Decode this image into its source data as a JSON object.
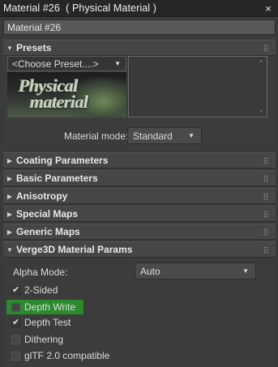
{
  "window": {
    "title": "Material #26  ( Physical Material )",
    "close_glyph": "×"
  },
  "name_field": {
    "value": "Material #26"
  },
  "presets": {
    "header": "Presets",
    "select_value": "<Choose Preset....>",
    "material_mode_label": "Material mode:",
    "material_mode_value": "Standard",
    "preview_logo_text": [
      "Physical",
      "material"
    ]
  },
  "rollouts": [
    {
      "label": "Coating Parameters",
      "expanded": false
    },
    {
      "label": "Basic Parameters",
      "expanded": false
    },
    {
      "label": "Anisotropy",
      "expanded": false
    },
    {
      "label": "Special Maps",
      "expanded": false
    },
    {
      "label": "Generic Maps",
      "expanded": false
    }
  ],
  "verge3d": {
    "header": "Verge3D Material Params",
    "alpha_mode_label": "Alpha Mode:",
    "alpha_mode_value": "Auto",
    "options": [
      {
        "label": "2-Sided",
        "checked": true,
        "highlighted": false
      },
      {
        "label": "Depth Write",
        "checked": false,
        "highlighted": true
      },
      {
        "label": "Depth Test",
        "checked": true,
        "highlighted": false
      },
      {
        "label": "Dithering",
        "checked": false,
        "highlighted": false
      },
      {
        "label": "glTF 2.0 compatible",
        "checked": false,
        "highlighted": false
      }
    ]
  },
  "colors": {
    "background": "#3a3a3a",
    "titlebar": "#262626",
    "highlight": "#2b8a2e",
    "rollout": "#464646"
  },
  "icons": [
    "close-icon",
    "expand-arrow-icon",
    "collapse-arrow-icon",
    "dropdown-arrow-icon",
    "grip-handle-icon",
    "checkmark-icon"
  ]
}
